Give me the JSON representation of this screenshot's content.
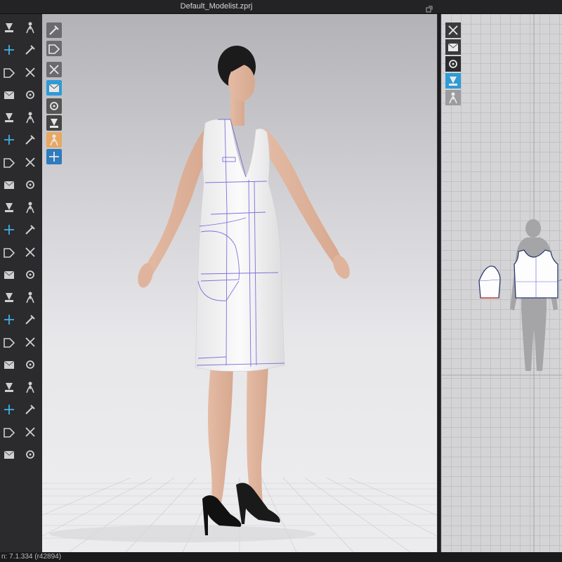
{
  "window": {
    "title": "Default_Modelist.zprj"
  },
  "status": {
    "version": "n: 7.1.334 (r42894)"
  },
  "toolbar_left": {
    "items": [
      "pattern-select-icon",
      "avatar-walk-icon",
      "transform-gizmo-icon",
      "move-icon",
      "edit-pattern-icon",
      "seam-tool-icon",
      "garment-fold-icon",
      "tack-icon",
      "pin-icon",
      "measure-icon",
      "internal-line-icon",
      "cut-icon",
      "segment-sewing-icon",
      "puckering-icon",
      "fabric-texture-icon",
      "topstitch-icon",
      "zipper-icon",
      "button-icon",
      "buttonhole-icon",
      "trim-icon",
      "fold-arrange-icon",
      "avatar-pose-icon",
      "arrangement-point-icon",
      "shirt-icon",
      "fitting-suit-icon",
      "strain-map-icon",
      "shading-icon",
      "hanger-icon",
      "pattern-layer-icon",
      "tape-icon",
      "jacket-icon",
      "fold-angle-icon"
    ],
    "colors": {
      "background": "#2b2b2d",
      "icon": "#cfcfcf",
      "accent": "#3fb0e8"
    }
  },
  "viewport3d_tools": {
    "items": [
      "simulation-icon",
      "garment-display-icon",
      "texture-display-icon",
      "fit-map-icon",
      "avatar-display-icon",
      "surface-icon",
      "skin-icon",
      "grid-display-icon"
    ]
  },
  "viewport2d_tools": {
    "items": [
      "brush-icon",
      "garment-2d-icon",
      "info-icon",
      "pattern-color-icon",
      "shirt-outline-icon"
    ]
  },
  "colors": {
    "viewport_top": "#b3b3b7",
    "viewport_bottom": "#eeeef0",
    "garment": "#f3f3f3",
    "pattern_lines": "#6a5ad6",
    "pattern_grid": "#d4d4d6"
  }
}
